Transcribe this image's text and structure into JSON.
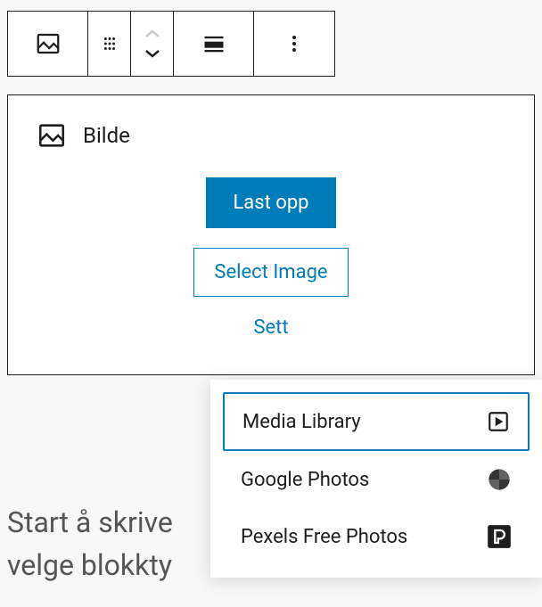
{
  "toolbar": {
    "block_icon": "image",
    "drag_icon": "drag",
    "move_up": "up",
    "move_down": "down",
    "align_icon": "align",
    "more_icon": "more"
  },
  "block": {
    "title": "Bilde",
    "upload_label": "Last opp",
    "select_label": "Select Image",
    "insert_url_label": "Sett"
  },
  "prompt": {
    "line1": "Start å skrive",
    "line2": "velge blokkty"
  },
  "dropdown": {
    "items": [
      {
        "label": "Media Library",
        "icon": "media-library",
        "selected": true
      },
      {
        "label": "Google Photos",
        "icon": "google-photos",
        "selected": false
      },
      {
        "label": "Pexels Free Photos",
        "icon": "pexels",
        "selected": false
      }
    ]
  }
}
